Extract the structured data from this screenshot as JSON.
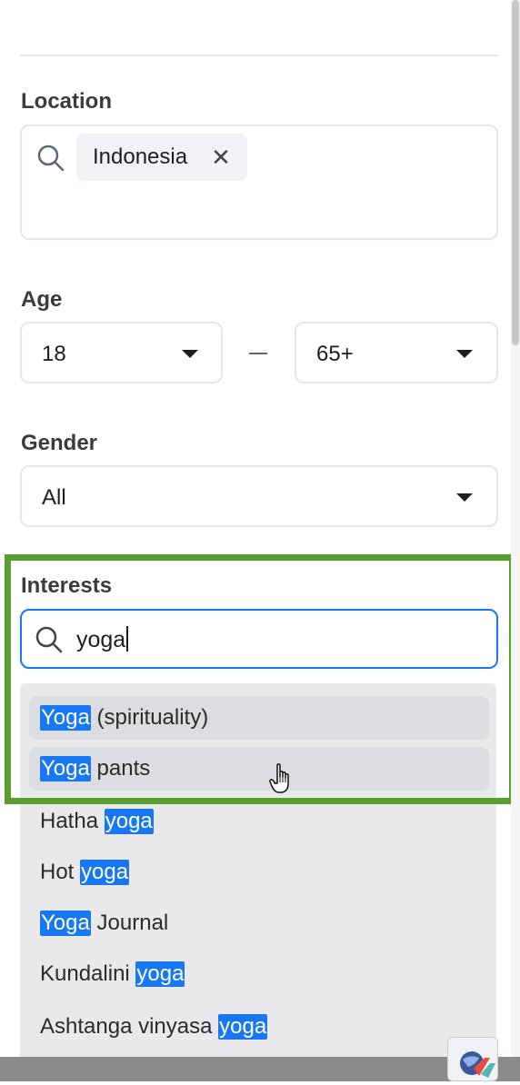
{
  "location": {
    "label": "Location",
    "chips": [
      {
        "text": "Indonesia",
        "remove_icon": "close-icon"
      }
    ]
  },
  "age": {
    "label": "Age",
    "min": "18",
    "max": "65+",
    "separator": "–"
  },
  "gender": {
    "label": "Gender",
    "value": "All"
  },
  "interests": {
    "label": "Interests",
    "query": "yoga",
    "suggestions": [
      {
        "highlight": "Yoga",
        "rest": " (spirituality)",
        "hover": true
      },
      {
        "highlight": "Yoga",
        "rest": " pants",
        "hover": true
      },
      {
        "prefix": "Hatha ",
        "highlight": "yoga",
        "hover": false
      },
      {
        "prefix": "Hot ",
        "highlight": "yoga",
        "hover": false
      },
      {
        "highlight": "Yoga",
        "rest": " Journal",
        "hover": false
      },
      {
        "prefix": "Kundalini ",
        "highlight": "yoga",
        "hover": false
      },
      {
        "prefix": "Ashtanga vinyasa ",
        "highlight": "yoga",
        "hover": false
      }
    ]
  },
  "colors": {
    "accent": "#1877f2",
    "annotation_frame": "#5a9e2f"
  }
}
